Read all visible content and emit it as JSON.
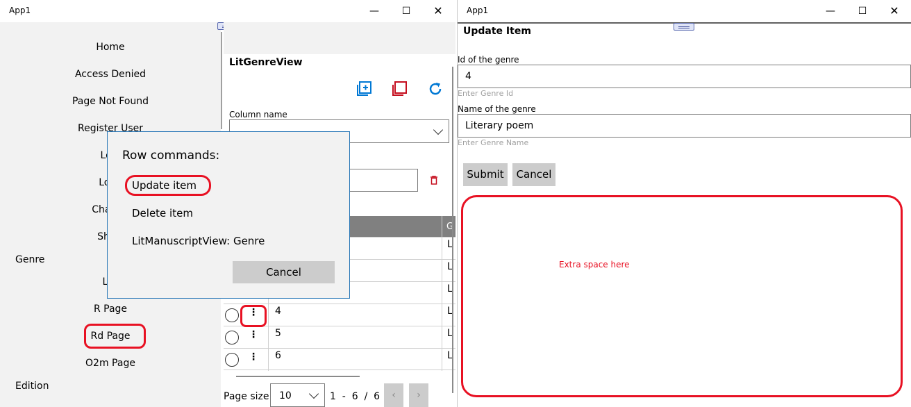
{
  "left_window": {
    "title": "App1",
    "nav": {
      "items": [
        "Home",
        "Access Denied",
        "Page Not Found",
        "Register User",
        "Logi",
        "Logo",
        "Change",
        "Show"
      ],
      "group_genre": "Genre",
      "genre_items": [
        "L D",
        "R Page",
        "Rd Page",
        "O2m Page"
      ],
      "group_edition": "Edition"
    },
    "view_title": "LitGenreView",
    "column_label": "Column name",
    "grid": {
      "rows": [
        {
          "id": "",
          "col2": "L"
        },
        {
          "id": "",
          "col2": "L"
        },
        {
          "id": "",
          "col2": "L"
        },
        {
          "id": "4",
          "col2": "L"
        },
        {
          "id": "5",
          "col2": "L"
        },
        {
          "id": "6",
          "col2": "L"
        }
      ],
      "header_partial": "G"
    },
    "pager": {
      "label": "Page size",
      "size": "10",
      "range": "1  -  6  /  6",
      "prev": "‹",
      "next": "›"
    },
    "dialog": {
      "title": "Row commands:",
      "commands": [
        "Update item",
        "Delete item",
        "LitManuscriptView: Genre"
      ],
      "cancel": "Cancel"
    }
  },
  "right_window": {
    "title": "App1",
    "form_title": "Update Item",
    "id_label": "Id of the genre",
    "id_value": "4",
    "id_hint": "Enter Genre Id",
    "name_label": "Name of the genre",
    "name_value": "Literary poem",
    "name_hint": "Enter Genre Name",
    "submit": "Submit",
    "cancel": "Cancel",
    "annotation": "Extra space here"
  },
  "colors": {
    "highlight": "#e81123",
    "accent_blue": "#0078d4",
    "delete_red": "#c50f1f"
  }
}
